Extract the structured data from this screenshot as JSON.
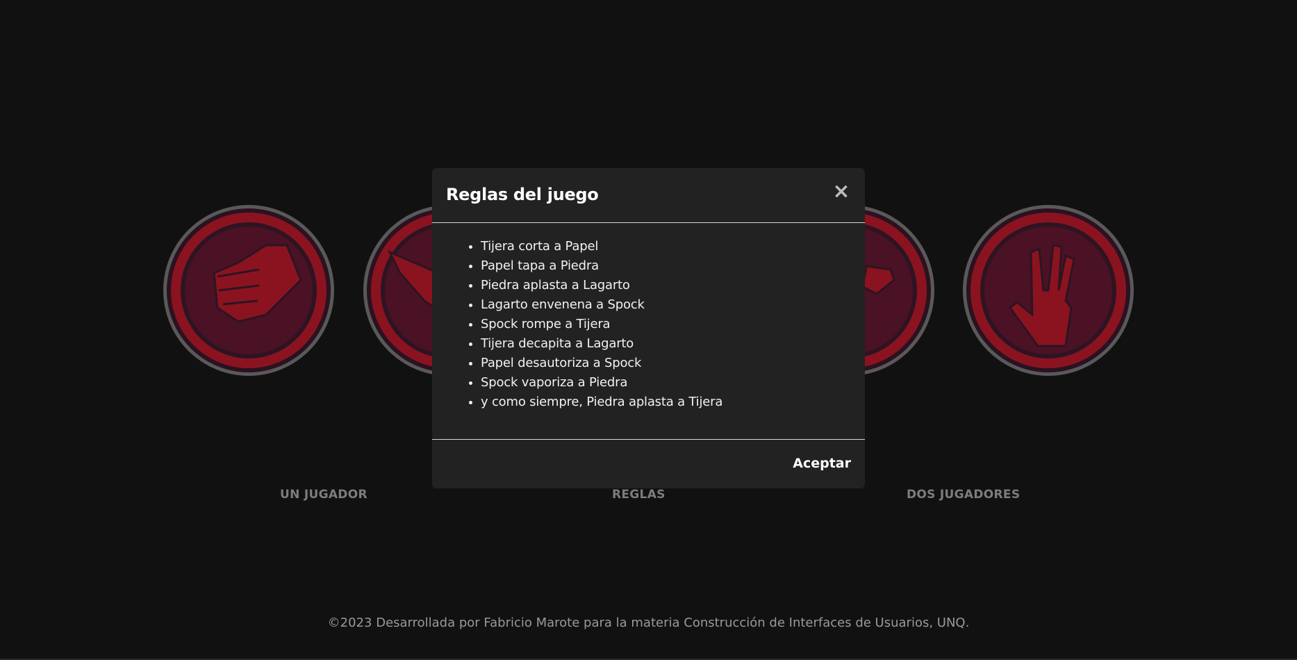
{
  "menu": {
    "one_player": "UN JUGADOR",
    "rules": "REGLAS",
    "two_players": "DOS JUGADORES"
  },
  "hands": [
    {
      "name": "piedra",
      "icon": "fist-icon"
    },
    {
      "name": "papel",
      "icon": "paper-hand-icon"
    },
    {
      "name": "tijera",
      "icon": "scissors-hand-icon"
    },
    {
      "name": "lagarto",
      "icon": "lizard-hand-icon"
    },
    {
      "name": "spock",
      "icon": "spock-hand-icon"
    }
  ],
  "modal": {
    "title": "Reglas del juego",
    "close_symbol": "×",
    "rules": [
      "Tijera corta a Papel",
      "Papel tapa a Piedra",
      "Piedra aplasta a Lagarto",
      "Lagarto envenena a Spock",
      "Spock rompe a Tijera",
      "Tijera decapita a Lagarto",
      "Papel desautoriza a Spock",
      "Spock vaporiza a Piedra",
      "y como siempre, Piedra aplasta a Tijera"
    ],
    "accept_label": "Aceptar"
  },
  "footer": {
    "text": "©2023 Desarrollada por Fabricio Marote para la materia Construcción de Interfaces de Usuarios, UNQ."
  },
  "colors": {
    "background": "#111111",
    "modal_bg": "#222222",
    "icon_red": "#8b1320",
    "icon_dark": "#4a1224"
  }
}
